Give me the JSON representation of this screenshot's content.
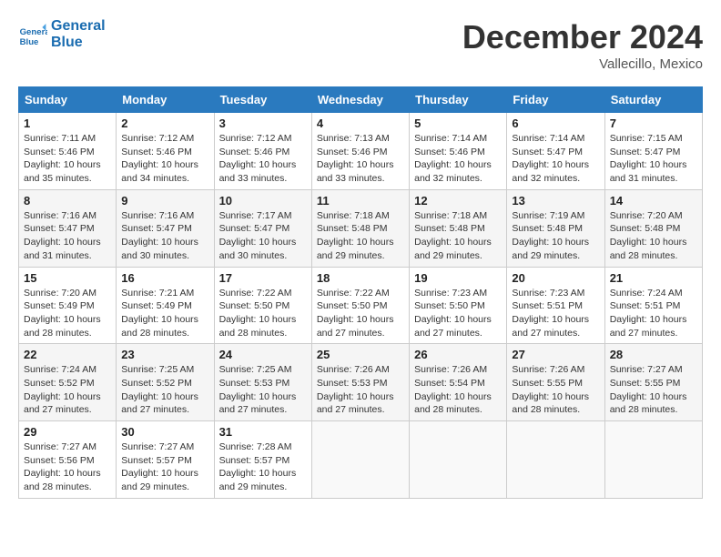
{
  "header": {
    "logo_line1": "General",
    "logo_line2": "Blue",
    "month": "December 2024",
    "location": "Vallecillo, Mexico"
  },
  "weekdays": [
    "Sunday",
    "Monday",
    "Tuesday",
    "Wednesday",
    "Thursday",
    "Friday",
    "Saturday"
  ],
  "weeks": [
    [
      {
        "day": "1",
        "info": "Sunrise: 7:11 AM\nSunset: 5:46 PM\nDaylight: 10 hours\nand 35 minutes."
      },
      {
        "day": "2",
        "info": "Sunrise: 7:12 AM\nSunset: 5:46 PM\nDaylight: 10 hours\nand 34 minutes."
      },
      {
        "day": "3",
        "info": "Sunrise: 7:12 AM\nSunset: 5:46 PM\nDaylight: 10 hours\nand 33 minutes."
      },
      {
        "day": "4",
        "info": "Sunrise: 7:13 AM\nSunset: 5:46 PM\nDaylight: 10 hours\nand 33 minutes."
      },
      {
        "day": "5",
        "info": "Sunrise: 7:14 AM\nSunset: 5:46 PM\nDaylight: 10 hours\nand 32 minutes."
      },
      {
        "day": "6",
        "info": "Sunrise: 7:14 AM\nSunset: 5:47 PM\nDaylight: 10 hours\nand 32 minutes."
      },
      {
        "day": "7",
        "info": "Sunrise: 7:15 AM\nSunset: 5:47 PM\nDaylight: 10 hours\nand 31 minutes."
      }
    ],
    [
      {
        "day": "8",
        "info": "Sunrise: 7:16 AM\nSunset: 5:47 PM\nDaylight: 10 hours\nand 31 minutes."
      },
      {
        "day": "9",
        "info": "Sunrise: 7:16 AM\nSunset: 5:47 PM\nDaylight: 10 hours\nand 30 minutes."
      },
      {
        "day": "10",
        "info": "Sunrise: 7:17 AM\nSunset: 5:47 PM\nDaylight: 10 hours\nand 30 minutes."
      },
      {
        "day": "11",
        "info": "Sunrise: 7:18 AM\nSunset: 5:48 PM\nDaylight: 10 hours\nand 29 minutes."
      },
      {
        "day": "12",
        "info": "Sunrise: 7:18 AM\nSunset: 5:48 PM\nDaylight: 10 hours\nand 29 minutes."
      },
      {
        "day": "13",
        "info": "Sunrise: 7:19 AM\nSunset: 5:48 PM\nDaylight: 10 hours\nand 29 minutes."
      },
      {
        "day": "14",
        "info": "Sunrise: 7:20 AM\nSunset: 5:48 PM\nDaylight: 10 hours\nand 28 minutes."
      }
    ],
    [
      {
        "day": "15",
        "info": "Sunrise: 7:20 AM\nSunset: 5:49 PM\nDaylight: 10 hours\nand 28 minutes."
      },
      {
        "day": "16",
        "info": "Sunrise: 7:21 AM\nSunset: 5:49 PM\nDaylight: 10 hours\nand 28 minutes."
      },
      {
        "day": "17",
        "info": "Sunrise: 7:22 AM\nSunset: 5:50 PM\nDaylight: 10 hours\nand 28 minutes."
      },
      {
        "day": "18",
        "info": "Sunrise: 7:22 AM\nSunset: 5:50 PM\nDaylight: 10 hours\nand 27 minutes."
      },
      {
        "day": "19",
        "info": "Sunrise: 7:23 AM\nSunset: 5:50 PM\nDaylight: 10 hours\nand 27 minutes."
      },
      {
        "day": "20",
        "info": "Sunrise: 7:23 AM\nSunset: 5:51 PM\nDaylight: 10 hours\nand 27 minutes."
      },
      {
        "day": "21",
        "info": "Sunrise: 7:24 AM\nSunset: 5:51 PM\nDaylight: 10 hours\nand 27 minutes."
      }
    ],
    [
      {
        "day": "22",
        "info": "Sunrise: 7:24 AM\nSunset: 5:52 PM\nDaylight: 10 hours\nand 27 minutes."
      },
      {
        "day": "23",
        "info": "Sunrise: 7:25 AM\nSunset: 5:52 PM\nDaylight: 10 hours\nand 27 minutes."
      },
      {
        "day": "24",
        "info": "Sunrise: 7:25 AM\nSunset: 5:53 PM\nDaylight: 10 hours\nand 27 minutes."
      },
      {
        "day": "25",
        "info": "Sunrise: 7:26 AM\nSunset: 5:53 PM\nDaylight: 10 hours\nand 27 minutes."
      },
      {
        "day": "26",
        "info": "Sunrise: 7:26 AM\nSunset: 5:54 PM\nDaylight: 10 hours\nand 28 minutes."
      },
      {
        "day": "27",
        "info": "Sunrise: 7:26 AM\nSunset: 5:55 PM\nDaylight: 10 hours\nand 28 minutes."
      },
      {
        "day": "28",
        "info": "Sunrise: 7:27 AM\nSunset: 5:55 PM\nDaylight: 10 hours\nand 28 minutes."
      }
    ],
    [
      {
        "day": "29",
        "info": "Sunrise: 7:27 AM\nSunset: 5:56 PM\nDaylight: 10 hours\nand 28 minutes."
      },
      {
        "day": "30",
        "info": "Sunrise: 7:27 AM\nSunset: 5:57 PM\nDaylight: 10 hours\nand 29 minutes."
      },
      {
        "day": "31",
        "info": "Sunrise: 7:28 AM\nSunset: 5:57 PM\nDaylight: 10 hours\nand 29 minutes."
      },
      null,
      null,
      null,
      null
    ]
  ]
}
